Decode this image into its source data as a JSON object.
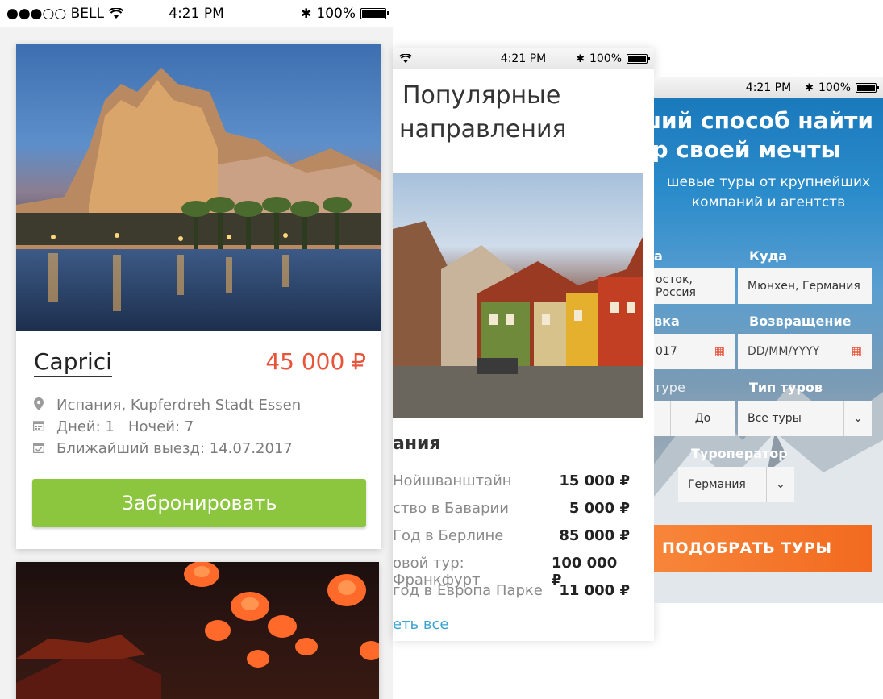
{
  "screen1": {
    "statusbar": {
      "carrier": "●●●○○ BELL",
      "time": "4:21 PM",
      "battery": "100%"
    },
    "card": {
      "title": "Caprici",
      "price": "45 000 ₽",
      "location": "Испания, Kupferdreh Stadt Essen",
      "duration": "Дней: 1   Ночей: 7",
      "departure": "Ближайший выезд: 14.07.2017",
      "button": "Забронировать"
    }
  },
  "screen2": {
    "statusbar": {
      "time": "4:21 PM",
      "battery": "100%"
    },
    "heading_line1": "Популярные",
    "heading_line2": "направления",
    "country": "ания",
    "tours": [
      {
        "name": "Нойшванштайн",
        "price": "15 000 ₽"
      },
      {
        "name": "ство в Баварии",
        "price": "5 000 ₽"
      },
      {
        "name": "Год в Берлине",
        "price": "85 000 ₽"
      },
      {
        "name": "овой тур: Франкфурт",
        "price": "100 000 ₽"
      },
      {
        "name": "год в Европа Парке",
        "price": "11 000 ₽"
      }
    ],
    "see_all": "еть все"
  },
  "screen3": {
    "statusbar": {
      "time": "4:21 PM",
      "battery": "100%"
    },
    "title_line1": "ший способ найти",
    "title_line2": "ур своей мечты",
    "subtitle_line1": "шевые туры от крупнейших",
    "subtitle_line2": "компаний и агентств",
    "from_label": "а",
    "from_value": "осток, Россия",
    "to_label": "Куда",
    "to_value": "Мюнхен, Германия",
    "depart_label": "вка",
    "depart_value": "017",
    "return_label": "Возвращение",
    "return_placeholder": "DD/MM/YYYY",
    "tour_label_left": "туре",
    "to_word": "До",
    "tour_type_label": "Тип туров",
    "tour_type_value": "Все туры",
    "operator_label": "Туроператор",
    "operator_value": "Германия",
    "button": "ПОДОБРАТЬ ТУРЫ"
  },
  "colors": {
    "accent_orange": "#e8543a",
    "book_green": "#8cc63f",
    "link_blue": "#3ba3d0",
    "cta_orange": "#f26a1f"
  }
}
